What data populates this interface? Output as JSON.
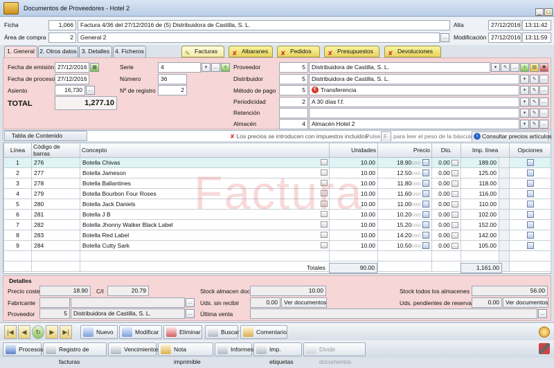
{
  "window": {
    "title": "Documentos de Proveedores - Hotel 2"
  },
  "header": {
    "ficha_label": "Ficha",
    "ficha_num": "1,066",
    "ficha_text": "Factura 4/36 del 27/12/2016 de (5) Distribuidora de Castilla, S. L.",
    "area_label": "Área de compra",
    "area_num": "2",
    "area_text": "General 2",
    "alta_label": "Alta",
    "alta_date": "27/12/2016",
    "alta_time": "13:11:42",
    "mod_label": "Modificación",
    "mod_date": "27/12/2016",
    "mod_time": "13:11:59"
  },
  "tabs": [
    {
      "label": "1. General"
    },
    {
      "label": "2. Otros datos"
    },
    {
      "label": "3. Detalles"
    },
    {
      "label": "4. Ficheros"
    }
  ],
  "doc_tabs": [
    {
      "label": "Facturas"
    },
    {
      "label": "Albaranes"
    },
    {
      "label": "Pedidos"
    },
    {
      "label": "Presupuestos"
    },
    {
      "label": "Devoluciones"
    }
  ],
  "general": {
    "fecha_emision_label": "Fecha de emisión",
    "fecha_emision": "27/12/2016",
    "fecha_proceso_label": "Fecha de proceso",
    "fecha_proceso": "27/12/2016",
    "asiento_label": "Asiento",
    "asiento": "16,730",
    "total_label": "TOTAL",
    "total": "1,277.10",
    "serie_label": "Serie",
    "serie": "4",
    "numero_label": "Número",
    "numero": "36",
    "registro_label": "Nº de registro",
    "registro": "2",
    "proveedor_label": "Proveedor",
    "proveedor_num": "5",
    "proveedor": "Distribuidora de Castilla, S. L.",
    "distribuidor_label": "Distribuidor",
    "distribuidor_num": "5",
    "distribuidor": "Distribuidora de Castilla, S. L.",
    "metodo_label": "Método de pago",
    "metodo_num": "5",
    "metodo": "Transferencia",
    "periodicidad_label": "Periodicidad",
    "periodicidad_num": "2",
    "periodicidad": "A 30 días f.f.",
    "retencion_label": "Retención",
    "almacen_label": "Almacén",
    "almacen_num": "4",
    "almacen": "Almacén Hotel 2"
  },
  "content_tab": "Tabla de Contenido",
  "infobar": {
    "impuestos": "Los precios se introducen con impuestos incluidos",
    "pulse": "Pulse",
    "bascula": "para leer el peso de la báscula",
    "consultar": "Consultar precios artículos"
  },
  "grid": {
    "headers": [
      "Línea",
      "Código de barras",
      "Concepto",
      "Unidades",
      "Precio",
      "Dto.",
      "Imp. línea",
      "Opciones"
    ],
    "rows": [
      {
        "linea": "1",
        "codigo": "276",
        "concepto": "Botella Chivas",
        "unidades": "10.00",
        "precio": "18.90",
        "importe": "189.00"
      },
      {
        "linea": "2",
        "codigo": "277",
        "concepto": "Botella Jameson",
        "unidades": "10.00",
        "precio": "12.50",
        "importe": "125.00"
      },
      {
        "linea": "3",
        "codigo": "278",
        "concepto": "Botella Ballantines",
        "unidades": "10.00",
        "precio": "11.80",
        "importe": "118.00"
      },
      {
        "linea": "4",
        "codigo": "279",
        "concepto": "Botella Bourbon Four Roses",
        "unidades": "10.00",
        "precio": "11.60",
        "importe": "116.00"
      },
      {
        "linea": "5",
        "codigo": "280",
        "concepto": "Botella Jack Daniels",
        "unidades": "10.00",
        "precio": "11.00",
        "importe": "110.00"
      },
      {
        "linea": "6",
        "codigo": "281",
        "concepto": "Botella J B",
        "unidades": "10.00",
        "precio": "10.20",
        "importe": "102.00"
      },
      {
        "linea": "7",
        "codigo": "282",
        "concepto": "Botella Jhonny Walker Black Label",
        "unidades": "10.00",
        "precio": "15.20",
        "importe": "152.00"
      },
      {
        "linea": "8",
        "codigo": "283",
        "concepto": "Botella Red Label",
        "unidades": "10.00",
        "precio": "14.20",
        "importe": "142.00"
      },
      {
        "linea": "9",
        "codigo": "284",
        "concepto": "Botella Cutty Sark",
        "unidades": "10.00",
        "precio": "10.50",
        "importe": "105.00"
      }
    ],
    "dto": "0.00",
    "totales_label": "Totales",
    "totales_unidades": "90.00",
    "totales_importe": "1,161.00"
  },
  "watermark": "Factura",
  "detalles": {
    "title": "Detalles",
    "precio_coste_label": "Precio coste",
    "precio_coste": "18.90",
    "ci_label": "C/I",
    "ci": "20.79",
    "fabricante_label": "Fabricante",
    "proveedor_label": "Proveedor",
    "proveedor_num": "5",
    "proveedor": "Distribuidora de Castilla, S. L.",
    "stock_doc_label": "Stock almacen doc.",
    "stock_doc": "10.00",
    "sin_recibir_label": "Uds. sin recibir",
    "sin_recibir": "0.00",
    "ver_docs": "Ver documentos",
    "ultima_venta_label": "Última venta",
    "stock_todos_label": "Stock todos los almacenes",
    "stock_todos": "56.00",
    "pendientes_label": "Uds. pendientes de reservar",
    "pendientes": "0.00"
  },
  "toolbar1": {
    "nuevo": "Nuevo",
    "modificar": "Modificar",
    "eliminar": "Eliminar",
    "buscar": "Buscar",
    "comentario": "Comentario"
  },
  "toolbar2": {
    "procesos": "Procesos",
    "registro": "Registro de facturas",
    "vencimientos": "Vencimientos",
    "nota": "Nota imprimible",
    "informes": "Informes",
    "etiquetas": "Imp. etiquetas",
    "dividir": "Dividir documentos"
  }
}
